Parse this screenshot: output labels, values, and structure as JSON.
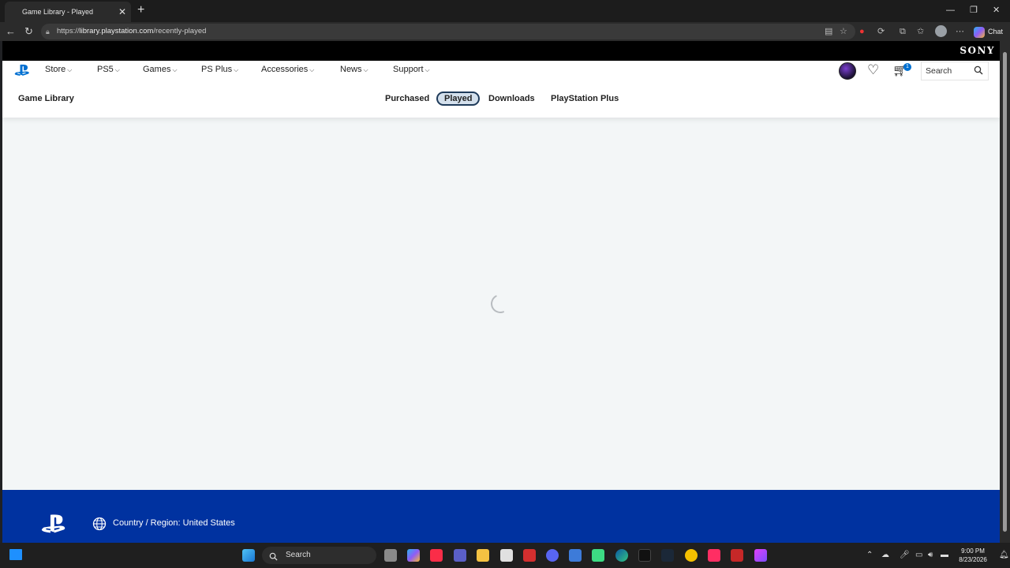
{
  "browser": {
    "tab_title": "Game Library - Played",
    "url_scheme": "https://",
    "url_host": "library.playstation.com",
    "url_path": "/recently-played",
    "chat_label": "Chat"
  },
  "header": {
    "brand": "SONY"
  },
  "nav": {
    "items": [
      {
        "label": "Store"
      },
      {
        "label": "PS5"
      },
      {
        "label": "Games"
      },
      {
        "label": "PS Plus"
      },
      {
        "label": "Accessories"
      },
      {
        "label": "News"
      },
      {
        "label": "Support"
      }
    ],
    "cart_count": "1",
    "search_placeholder": "Search"
  },
  "library": {
    "title": "Game Library",
    "tabs": [
      {
        "label": "Purchased",
        "active": false
      },
      {
        "label": "Played",
        "active": true
      },
      {
        "label": "Downloads",
        "active": false
      },
      {
        "label": "PlayStation Plus",
        "active": false
      }
    ]
  },
  "footer": {
    "region_text": "Country / Region: United States"
  },
  "taskbar": {
    "search_label": "Search",
    "time": "9:00 PM",
    "date": "8/23/2026"
  },
  "colors": {
    "footer_bg": "#0032a0",
    "page_bg": "#f3f6f7",
    "active_tab_bg": "#d4e0ec",
    "cart_badge": "#0070d1"
  }
}
